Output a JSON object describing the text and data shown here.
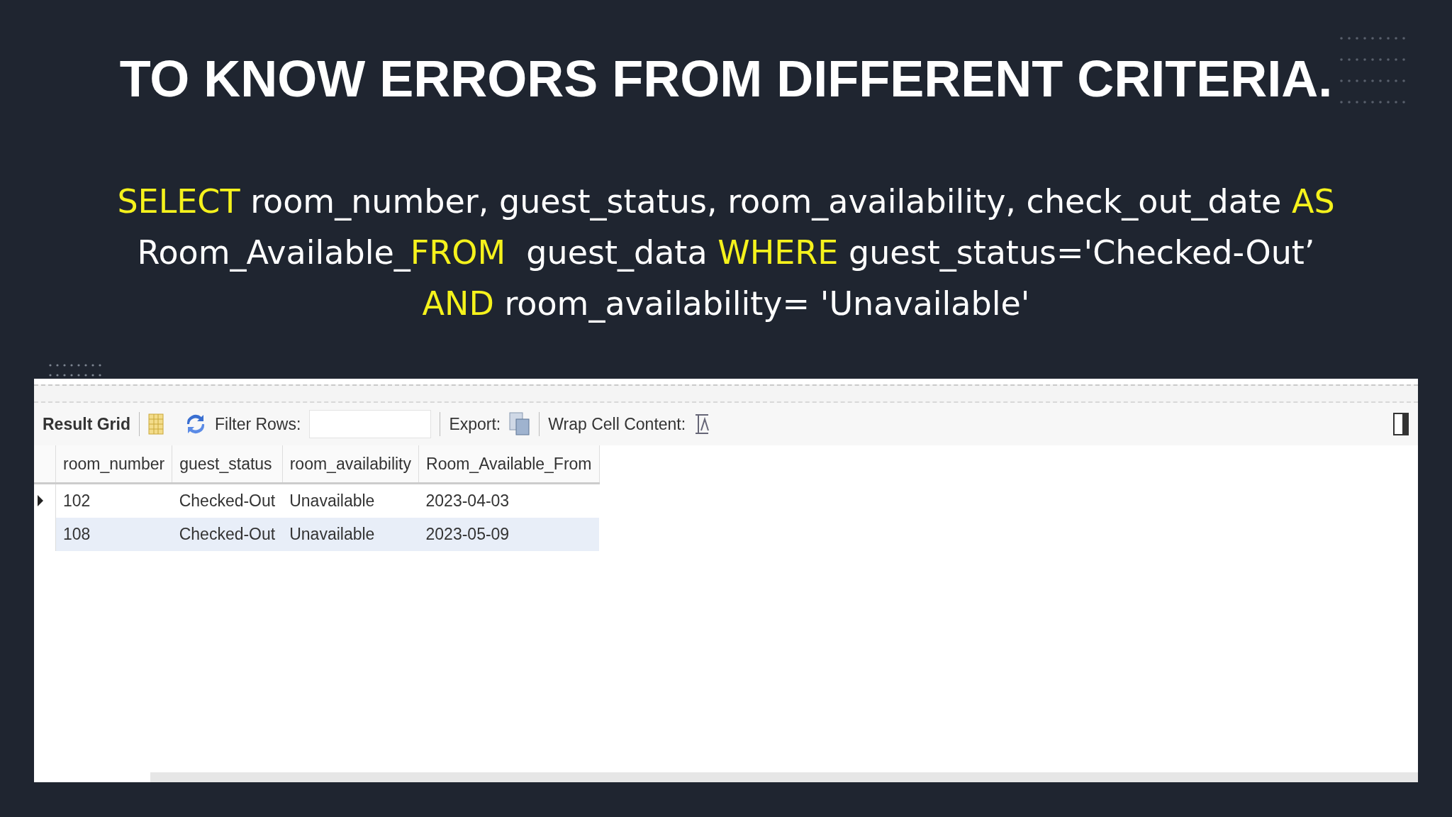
{
  "slide": {
    "title": "TO KNOW ERRORS FROM DIFFERENT CRITERIA.",
    "query_lines": [
      [
        {
          "kind": "keyword",
          "text": "SELECT"
        },
        {
          "kind": "text",
          "text": " room_number, guest_status, room_availability, check_out_date "
        },
        {
          "kind": "keyword",
          "text": "AS"
        }
      ],
      [
        {
          "kind": "text",
          "text": "Room_Available_"
        },
        {
          "kind": "keyword",
          "text": "FROM"
        },
        {
          "kind": "text",
          "text": "  guest_data "
        },
        {
          "kind": "keyword",
          "text": "WHERE"
        },
        {
          "kind": "text",
          "text": " guest_status='Checked-Out’"
        }
      ],
      [
        {
          "kind": "keyword",
          "text": "AND"
        },
        {
          "kind": "text",
          "text": " room_availability= 'Unavailable'"
        }
      ]
    ]
  },
  "result_panel": {
    "toolbar": {
      "result_grid_label": "Result Grid",
      "filter_label": "Filter Rows:",
      "export_label": "Export:",
      "wrap_label": "Wrap Cell Content:"
    },
    "table": {
      "columns": [
        "room_number",
        "guest_status",
        "room_availability",
        "Room_Available_From"
      ],
      "rows": [
        {
          "current": true,
          "selected": false,
          "cells": [
            "102",
            "Checked-Out",
            "Unavailable",
            "2023-04-03"
          ]
        },
        {
          "current": false,
          "selected": true,
          "cells": [
            "108",
            "Checked-Out",
            "Unavailable",
            "2023-05-09"
          ]
        }
      ]
    }
  }
}
